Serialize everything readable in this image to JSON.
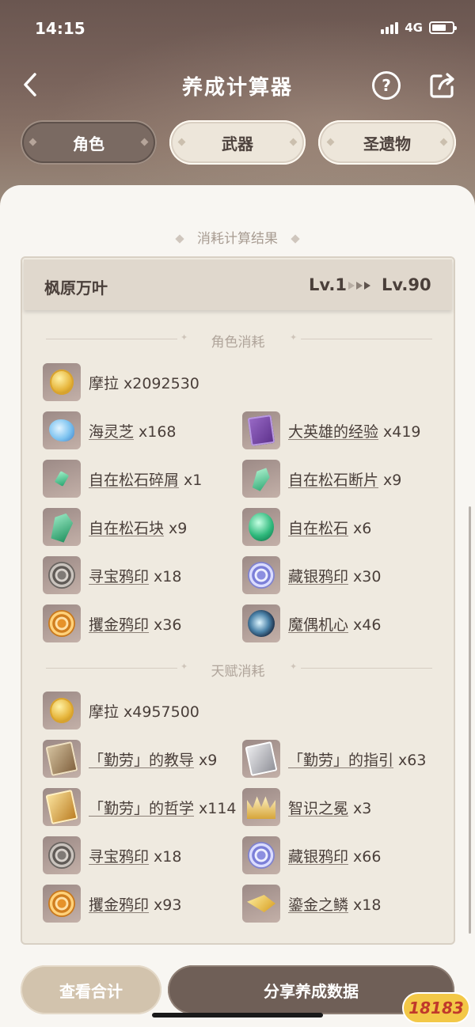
{
  "status": {
    "time": "14:15",
    "network": "4G"
  },
  "nav": {
    "title": "养成计算器",
    "help_symbol": "?"
  },
  "tabs": [
    {
      "label": "角色",
      "active": true
    },
    {
      "label": "武器",
      "active": false
    },
    {
      "label": "圣遗物",
      "active": false
    }
  ],
  "result": {
    "title": "消耗计算结果",
    "character": "枫原万叶",
    "level_from": "Lv.1",
    "level_to": "Lv.90"
  },
  "char_cost": {
    "title": "角色消耗",
    "items": [
      {
        "name": "摩拉",
        "qty": "x2092530",
        "icon": "mora-coin-icon"
      },
      {
        "name": "海灵芝",
        "qty": "x168",
        "icon": "sea-ganoderma-icon"
      },
      {
        "name": "大英雄的经验",
        "qty": "x419",
        "icon": "heros-wit-book-icon"
      },
      {
        "name": "自在松石碎屑",
        "qty": "x1",
        "icon": "turquoise-sliver-icon"
      },
      {
        "name": "自在松石断片",
        "qty": "x9",
        "icon": "turquoise-fragment-icon"
      },
      {
        "name": "自在松石块",
        "qty": "x9",
        "icon": "turquoise-chunk-icon"
      },
      {
        "name": "自在松石",
        "qty": "x6",
        "icon": "turquoise-gemstone-icon"
      },
      {
        "name": "寻宝鸦印",
        "qty": "x18",
        "icon": "treasure-hoarder-insignia-icon"
      },
      {
        "name": "藏银鸦印",
        "qty": "x30",
        "icon": "silver-raven-insignia-icon"
      },
      {
        "name": "攫金鸦印",
        "qty": "x36",
        "icon": "golden-raven-insignia-icon"
      },
      {
        "name": "魔偶机心",
        "qty": "x46",
        "icon": "maguu-kishin-icon"
      }
    ]
  },
  "talent_cost": {
    "title": "天赋消耗",
    "items": [
      {
        "name": "摩拉",
        "qty": "x4957500",
        "icon": "mora-coin-icon"
      },
      {
        "name": "「勤劳」的教导",
        "qty": "x9",
        "icon": "teachings-diligence-icon"
      },
      {
        "name": "「勤劳」的指引",
        "qty": "x63",
        "icon": "guide-diligence-icon"
      },
      {
        "name": "「勤劳」的哲学",
        "qty": "x114",
        "icon": "philosophies-diligence-icon"
      },
      {
        "name": "智识之冕",
        "qty": "x3",
        "icon": "crown-of-insight-icon"
      },
      {
        "name": "寻宝鸦印",
        "qty": "x18",
        "icon": "treasure-hoarder-insignia-icon"
      },
      {
        "name": "藏银鸦印",
        "qty": "x66",
        "icon": "silver-raven-insignia-icon"
      },
      {
        "name": "攫金鸦印",
        "qty": "x93",
        "icon": "golden-raven-insignia-icon"
      },
      {
        "name": "鎏金之鳞",
        "qty": "x18",
        "icon": "gilded-scale-icon"
      }
    ]
  },
  "buttons": {
    "total": "查看合计",
    "share": "分享养成数据"
  },
  "watermark": "18183"
}
